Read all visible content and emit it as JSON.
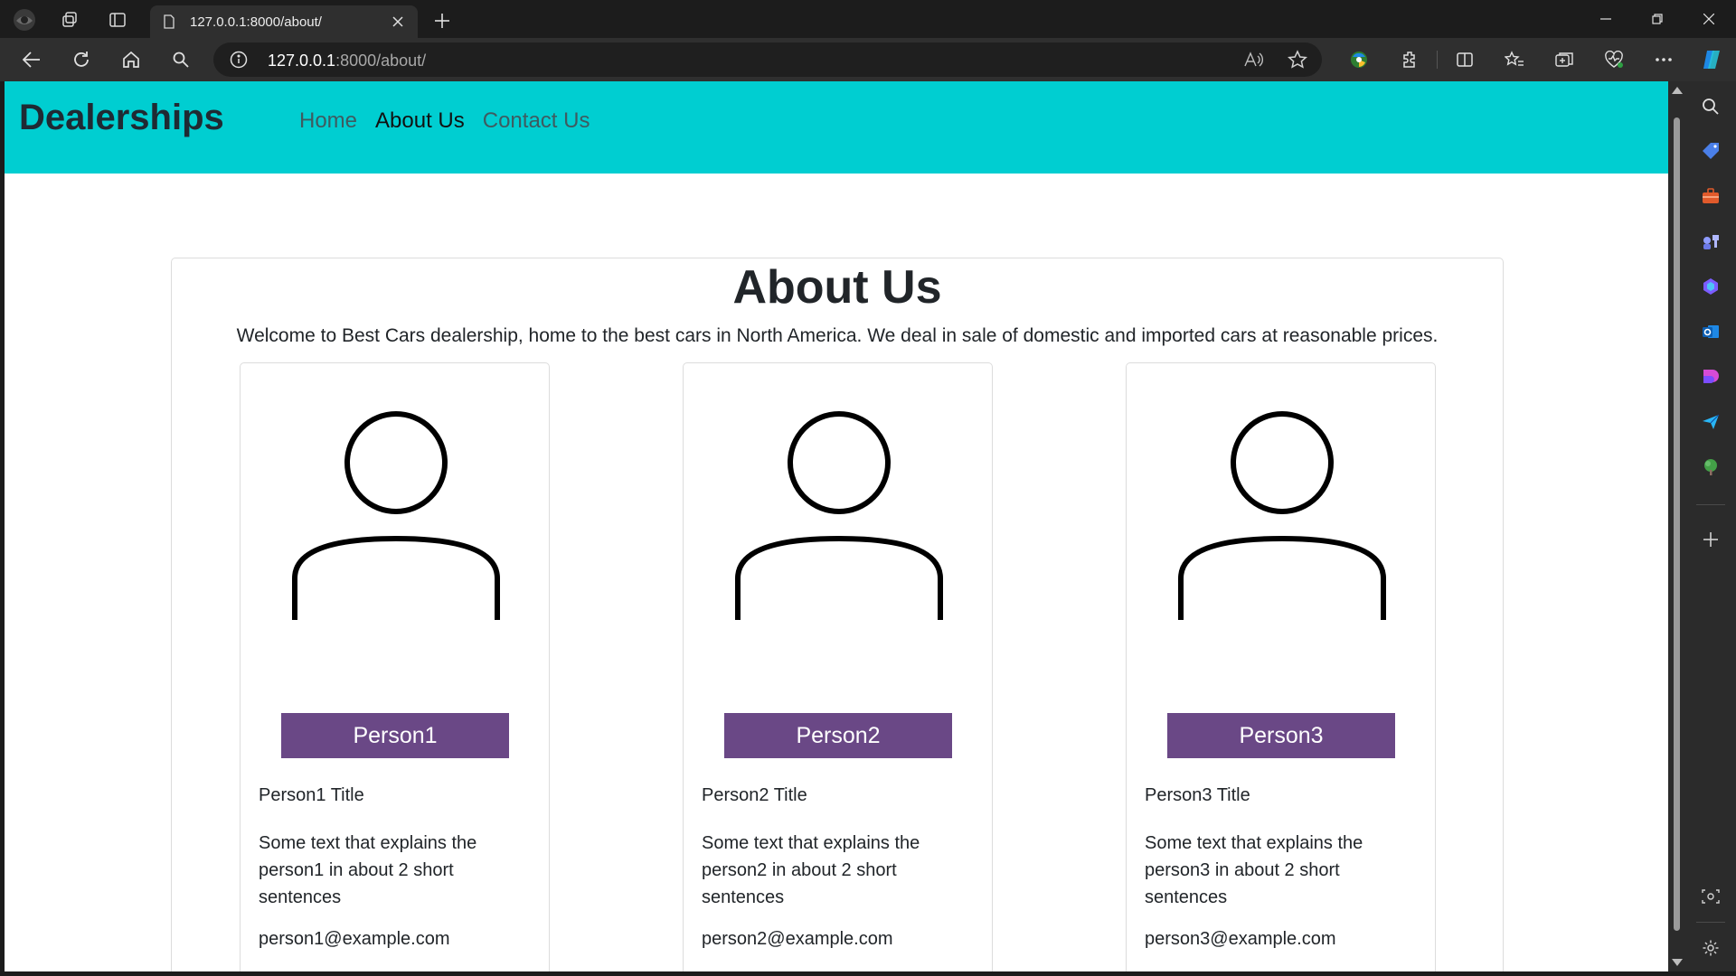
{
  "browser": {
    "tab_title": "127.0.0.1:8000/about/",
    "url_host": "127.0.0.1",
    "url_path": ":8000/about/"
  },
  "site": {
    "brand": "Dealerships",
    "nav": [
      {
        "label": "Home",
        "active": false
      },
      {
        "label": "About Us",
        "active": true
      },
      {
        "label": "Contact Us",
        "active": false
      }
    ]
  },
  "about": {
    "title": "About Us",
    "description": "Welcome to Best Cars dealership, home to the best cars in North America. We deal in sale of domestic and imported cars at reasonable prices."
  },
  "people": [
    {
      "name": "Person1",
      "title": "Person1 Title",
      "text": "Some text that explains the person1 in about 2 short sentences",
      "email": "person1@example.com"
    },
    {
      "name": "Person2",
      "title": "Person2 Title",
      "text": "Some text that explains the person2 in about 2 short sentences",
      "email": "person2@example.com"
    },
    {
      "name": "Person3",
      "title": "Person3 Title",
      "text": "Some text that explains the person3 in about 2 short sentences",
      "email": "person3@example.com"
    }
  ],
  "colors": {
    "navbar": "#00ced1",
    "person_button": "#6a4886",
    "browser_dark": "#1c1c1c"
  },
  "icons": {
    "avatar": "person-outline-icon"
  }
}
